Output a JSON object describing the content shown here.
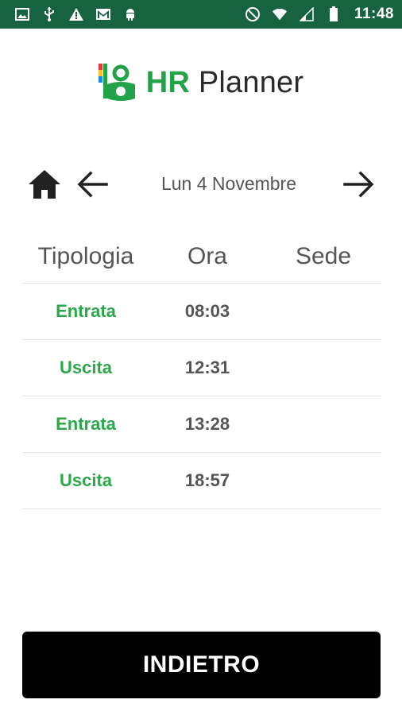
{
  "status_bar": {
    "time": "11:48",
    "left_icons": [
      "image-icon",
      "usb-icon",
      "warning-icon",
      "gmail-icon",
      "android-icon"
    ],
    "right_icons": [
      "do-not-disturb-icon",
      "wifi-icon",
      "signal-icon",
      "battery-icon"
    ],
    "background_color": "#17623f"
  },
  "logo": {
    "brand_hr": "HR",
    "brand_planner": " Planner",
    "brand_color": "#22a34a"
  },
  "date_nav": {
    "date_label": "Lun 4 Novembre",
    "home_icon": "home-icon",
    "prev_icon": "arrow-left-icon",
    "next_icon": "arrow-right-icon"
  },
  "table": {
    "headers": [
      "Tipologia",
      "Ora",
      "Sede"
    ],
    "rows": [
      {
        "tipologia": "Entrata",
        "ora": "08:03",
        "sede": ""
      },
      {
        "tipologia": "Uscita",
        "ora": "12:31",
        "sede": ""
      },
      {
        "tipologia": "Entrata",
        "ora": "13:28",
        "sede": ""
      },
      {
        "tipologia": "Uscita",
        "ora": "18:57",
        "sede": ""
      }
    ],
    "type_color": "#2aa84a"
  },
  "footer": {
    "back_label": "INDIETRO"
  }
}
